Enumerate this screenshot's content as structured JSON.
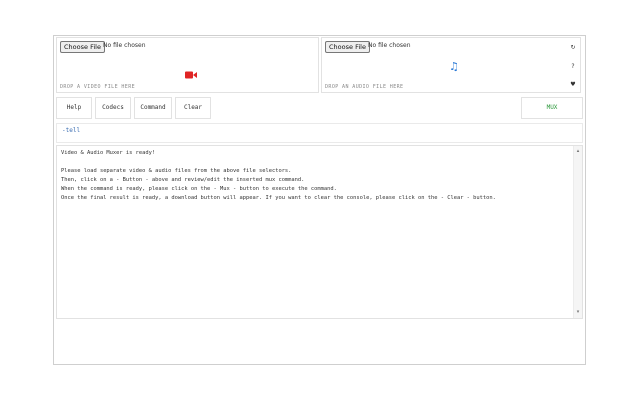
{
  "video_panel": {
    "choose_file_label": "Choose File",
    "file_status": "No file chosen",
    "drop_hint": "DROP A VIDEO FILE HERE",
    "icon": "video-camera-icon",
    "icon_color": "#e02424"
  },
  "audio_panel": {
    "choose_file_label": "Choose File",
    "file_status": "No file chosen",
    "drop_hint": "DROP AN AUDIO FILE HERE",
    "icon": "music-note-icon",
    "icon_glyph": "♫",
    "icon_color": "#2a79d6"
  },
  "side_icons": {
    "top": "↻",
    "middle": "?",
    "bottom": "♥"
  },
  "toolbar": {
    "help_label": "Help",
    "codecs_label": "Codecs",
    "command_label": "Command",
    "clear_label": "Clear",
    "mux_label": "MUX",
    "mux_color": "#2f9a3e"
  },
  "command_input": {
    "value": "-tell"
  },
  "console": {
    "lines": [
      "Video & Audio Muxer is ready!",
      "",
      "Please load separate video & audio files from the above file selectors.",
      "Then, click on a - Button - above and review/edit the inserted mux command.",
      "When the command is ready, please click on the - Mux - button to execute the command.",
      "Once the final result is ready, a download button will appear. If you want to clear the console, please click on the - Clear - button."
    ],
    "scroll_up": "▴",
    "scroll_down": "▾"
  }
}
